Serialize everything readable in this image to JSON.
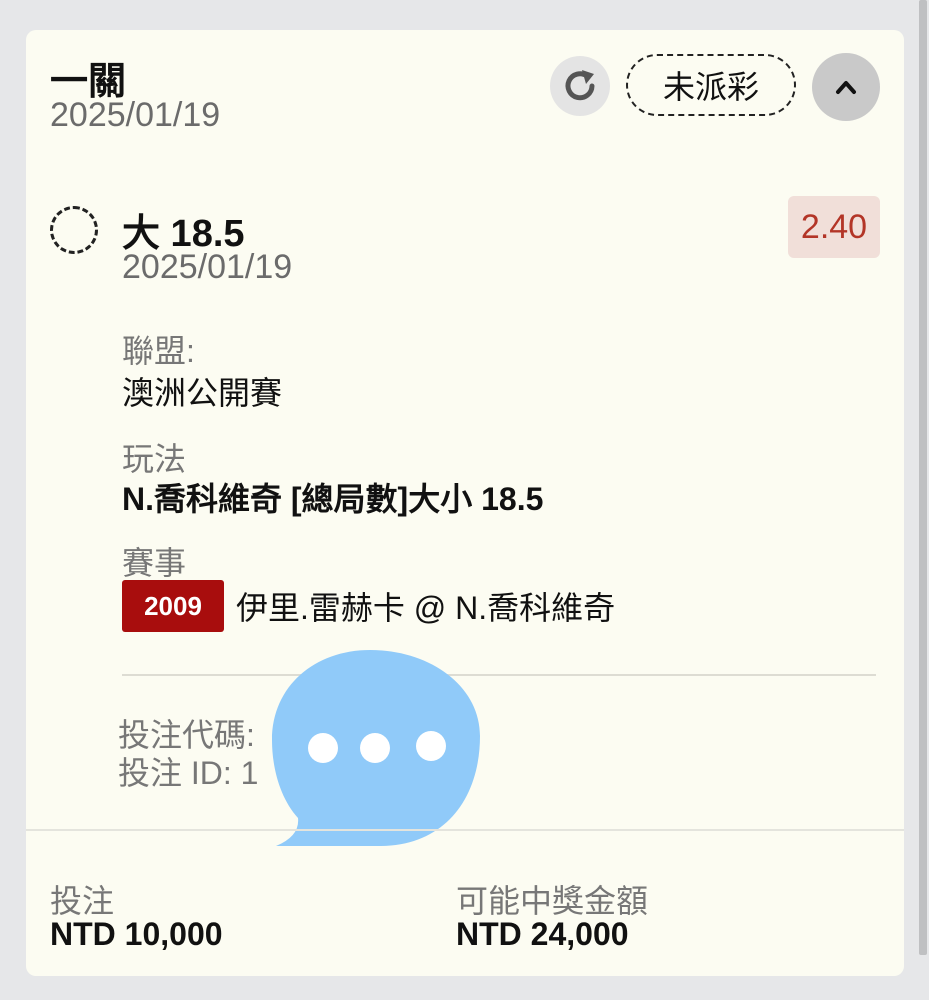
{
  "header": {
    "title": "一關",
    "date": "2025/01/19",
    "status": "未派彩"
  },
  "bet": {
    "selection": "大 18.5",
    "date": "2025/01/19",
    "odds": "2.40",
    "league_label": "聯盟:",
    "league_value": "澳洲公開賽",
    "market_label": "玩法",
    "market_value": "N.喬科維奇 [總局數]大小 18.5",
    "event_label": "賽事",
    "event_code": "2009",
    "event_name": "伊里.雷赫卡 @ N.喬科維奇",
    "bet_code_label": "投注代碼:",
    "bet_id_label": "投注 ID: 1"
  },
  "footer": {
    "stake_label": "投注",
    "stake_value": "NTD 10,000",
    "payout_label": "可能中獎金額",
    "payout_value": "NTD 24,000"
  },
  "colors": {
    "card_bg": "#fcfcf2",
    "odds_text": "#b33527",
    "event_code_bg": "#a80d0d",
    "chat_bubble": "#90caf9"
  },
  "icons": [
    "refresh-icon",
    "chevron-up-icon",
    "chat-bubble-icon"
  ]
}
